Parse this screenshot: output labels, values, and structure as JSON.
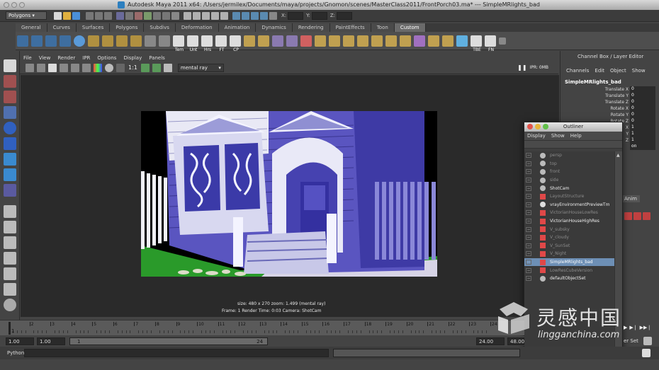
{
  "titlebar": {
    "title": "Autodesk Maya 2011 x64: /Users/jermilex/Documents/maya/projects/Gnomon/scenes/MasterClass2011/FrontPorch03.ma*   ---   SimpleMRlights_bad"
  },
  "statusline": {
    "menu_set": "Polygons",
    "x_label": "X:",
    "y_label": "Y:",
    "z_label": "Z:"
  },
  "shelf": {
    "tabs": [
      "General",
      "Curves",
      "Surfaces",
      "Polygons",
      "Subdivs",
      "Deformation",
      "Animation",
      "Dynamics",
      "Rendering",
      "PaintEffects",
      "Toon",
      "Custom"
    ],
    "active_tab": "Custom",
    "icon_labels": [
      "Tem",
      "Unt",
      "Hrs",
      "FT",
      "CP",
      "TBE",
      "FN"
    ]
  },
  "panel": {
    "menus": [
      "File",
      "View",
      "Render",
      "IPR",
      "Options",
      "Display",
      "Panels"
    ],
    "ratio_label": "1:1",
    "renderer": "mental ray",
    "ipr_label": "IPR: 0MB"
  },
  "render_info": {
    "line1": "size: 480 x 270 zoom: 1.499       (mental ray)",
    "line2": "Frame: 1        Render Time: 0:03        Camera: ShotCam"
  },
  "channel_box": {
    "header": "Channel Box / Layer Editor",
    "menus": [
      "Channels",
      "Edit",
      "Object",
      "Show"
    ],
    "object_name": "SimpleMRlights_bad",
    "attributes": [
      {
        "name": "Translate X",
        "value": "0"
      },
      {
        "name": "Translate Y",
        "value": "0"
      },
      {
        "name": "Translate Z",
        "value": "0"
      },
      {
        "name": "Rotate X",
        "value": "0"
      },
      {
        "name": "Rotate Y",
        "value": "0"
      },
      {
        "name": "Rotate Z",
        "value": "0"
      },
      {
        "name": "X",
        "value": "1"
      },
      {
        "name": "Y",
        "value": "1"
      },
      {
        "name": "Z",
        "value": "1"
      },
      {
        "name": "",
        "value": "on"
      }
    ],
    "layer_tab": "Anim"
  },
  "outliner": {
    "title": "Outliner",
    "menus": [
      "Display",
      "Show",
      "Help"
    ],
    "items": [
      {
        "label": "persp",
        "dim": true,
        "icon": "camera-icon",
        "selected": false
      },
      {
        "label": "top",
        "dim": true,
        "icon": "camera-icon",
        "selected": false
      },
      {
        "label": "front",
        "dim": true,
        "icon": "camera-icon",
        "selected": false
      },
      {
        "label": "side",
        "dim": true,
        "icon": "camera-icon",
        "selected": false
      },
      {
        "label": "ShotCam",
        "dim": false,
        "icon": "camera-icon",
        "selected": false
      },
      {
        "label": "LayoutStructure",
        "dim": true,
        "icon": "group-icon",
        "selected": false
      },
      {
        "label": "vrayEnvironmentPreviewTm",
        "dim": false,
        "icon": "sphere-icon",
        "selected": false
      },
      {
        "label": "VictorianHouseLowRes",
        "dim": true,
        "icon": "group-icon",
        "selected": false
      },
      {
        "label": "VictorianHouseHighRes",
        "dim": false,
        "icon": "group-icon",
        "selected": false
      },
      {
        "label": "V_subsky",
        "dim": true,
        "icon": "group-icon",
        "selected": false
      },
      {
        "label": "V_cloudy",
        "dim": true,
        "icon": "group-icon",
        "selected": false
      },
      {
        "label": "V_SunSet",
        "dim": true,
        "icon": "group-icon",
        "selected": false
      },
      {
        "label": "V_Night",
        "dim": true,
        "icon": "group-icon",
        "selected": false
      },
      {
        "label": "SimpleMRlights_bad",
        "dim": false,
        "icon": "group-icon",
        "selected": true
      },
      {
        "label": "LowResCubeVersion",
        "dim": true,
        "icon": "group-icon",
        "selected": false
      },
      {
        "label": "defaultObjectSet",
        "dim": false,
        "icon": "set-icon",
        "selected": false
      }
    ]
  },
  "timeline": {
    "ticks": [
      "1",
      "2",
      "3",
      "4",
      "5",
      "6",
      "7",
      "8",
      "9",
      "10",
      "11",
      "12",
      "13",
      "14",
      "15",
      "16",
      "17",
      "18",
      "19",
      "20",
      "21",
      "22",
      "23",
      "24"
    ],
    "current_frame": "1",
    "range_start": "1.00",
    "playback_start": "1.00",
    "slider_start": "1",
    "slider_end": "24",
    "playback_end": "24.00",
    "range_end": "48.00",
    "char_set": "er Set"
  },
  "cmdline": {
    "label": "Python"
  },
  "watermark": {
    "cn_text": "灵感中国",
    "domain": "lingganchina.com"
  },
  "colors": {
    "accent_selected": "#6d8fb5",
    "render_bg": "#000000",
    "viewport_bg": "#2a2a2a"
  }
}
